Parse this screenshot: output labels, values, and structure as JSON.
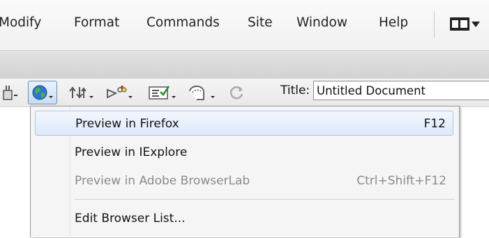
{
  "menubar": {
    "items": [
      "Modify",
      "Format",
      "Commands",
      "Site",
      "Window",
      "Help"
    ],
    "layout_icon": "workspace-layout-icon"
  },
  "toolbar": {
    "icons": [
      "code-navigator-icon",
      "preview-globe-icon",
      "file-management-icon",
      "visual-aids-icon",
      "check-page-icon",
      "validate-markup-icon",
      "refresh-icon"
    ],
    "title_label": "Title:",
    "title_value": "Untitled Document"
  },
  "dropdown": {
    "items": [
      {
        "label": "Preview in Firefox",
        "shortcut": "F12",
        "state": "highlighted"
      },
      {
        "label": "Preview in IExplore",
        "shortcut": "",
        "state": "normal"
      },
      {
        "label": "Preview in Adobe BrowserLab",
        "shortcut": "Ctrl+Shift+F12",
        "state": "disabled"
      },
      {
        "label": "Edit Browser List...",
        "shortcut": "",
        "state": "normal"
      }
    ]
  },
  "colors": {
    "highlight_border": "#a9c6ea",
    "highlight_fill": "#dde9f9",
    "disabled_text": "#8a8a8a"
  }
}
